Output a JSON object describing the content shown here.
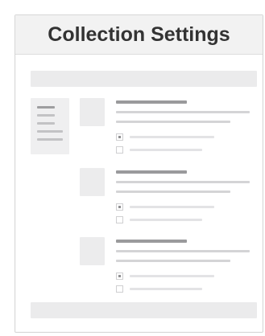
{
  "header": {
    "title": "Collection Settings"
  },
  "collections": [
    {
      "options": [
        {
          "checked": true
        },
        {
          "checked": false
        }
      ]
    },
    {
      "options": [
        {
          "checked": true
        },
        {
          "checked": false
        }
      ]
    },
    {
      "options": [
        {
          "checked": true
        },
        {
          "checked": false
        }
      ]
    }
  ]
}
